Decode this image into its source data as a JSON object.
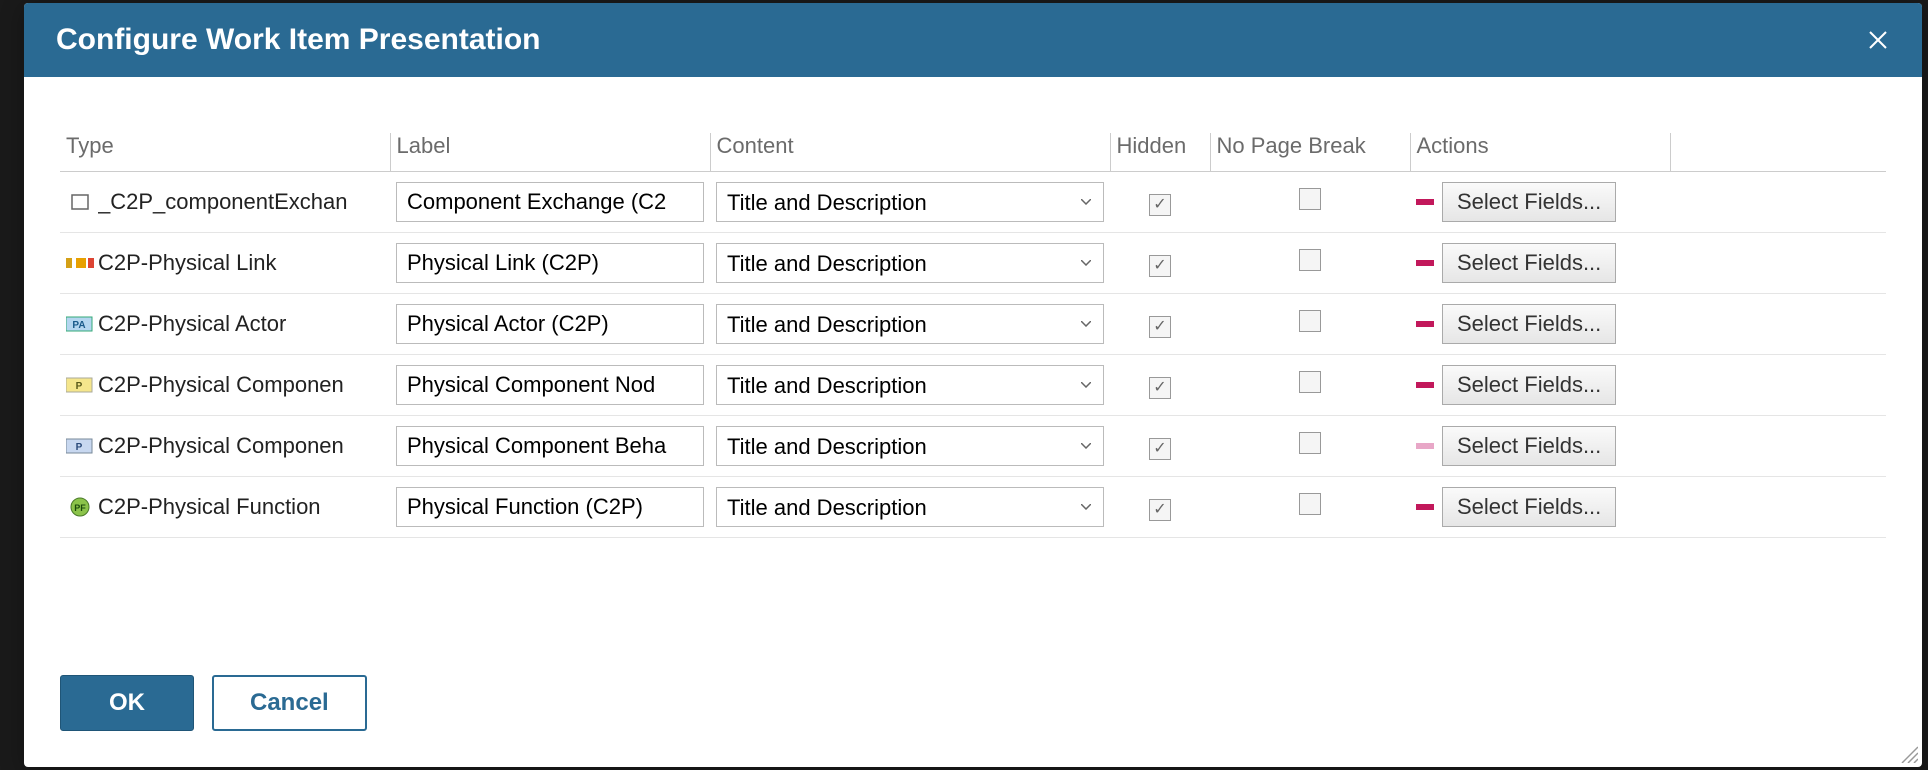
{
  "dialog": {
    "title": "Configure Work Item Presentation",
    "ok_label": "OK",
    "cancel_label": "Cancel"
  },
  "columns": {
    "type": "Type",
    "label": "Label",
    "content": "Content",
    "hidden": "Hidden",
    "no_page_break": "No Page Break",
    "actions": "Actions"
  },
  "content_options": [
    "Title and Description"
  ],
  "select_fields_label": "Select Fields...",
  "rows": [
    {
      "icon": "box-icon",
      "type_name": "_C2P_componentExchan",
      "label": "Component Exchange (C2",
      "content": "Title and Description",
      "hidden": true,
      "no_page_break": false,
      "remove_variant": "strong"
    },
    {
      "icon": "physical-link-icon",
      "type_name": "C2P-Physical Link",
      "label": "Physical Link (C2P)",
      "content": "Title and Description",
      "hidden": true,
      "no_page_break": false,
      "remove_variant": "strong"
    },
    {
      "icon": "physical-actor-icon",
      "type_name": "C2P-Physical Actor",
      "label": "Physical Actor (C2P)",
      "content": "Title and Description",
      "hidden": true,
      "no_page_break": false,
      "remove_variant": "strong"
    },
    {
      "icon": "physical-node-icon",
      "type_name": "C2P-Physical Componen",
      "label": "Physical Component Nod",
      "content": "Title and Description",
      "hidden": true,
      "no_page_break": false,
      "remove_variant": "strong"
    },
    {
      "icon": "physical-behavior-icon",
      "type_name": "C2P-Physical Componen",
      "label": "Physical Component Beha",
      "content": "Title and Description",
      "hidden": true,
      "no_page_break": false,
      "remove_variant": "light"
    },
    {
      "icon": "physical-function-icon",
      "type_name": "C2P-Physical Function",
      "label": "Physical Function (C2P)",
      "content": "Title and Description",
      "hidden": true,
      "no_page_break": false,
      "remove_variant": "strong"
    }
  ]
}
